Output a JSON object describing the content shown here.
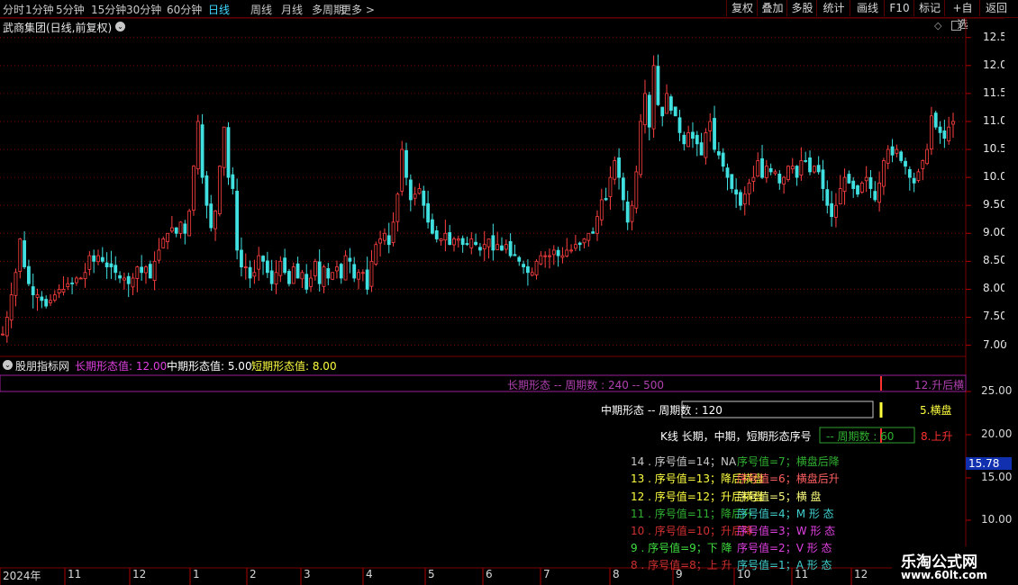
{
  "toolbar": {
    "periods": [
      {
        "label": "分时",
        "active": false
      },
      {
        "label": "1分钟",
        "active": false
      },
      {
        "label": "5分钟",
        "active": false
      },
      {
        "label": "15分钟",
        "active": false
      },
      {
        "label": "30分钟",
        "active": false
      },
      {
        "label": "60分钟",
        "active": false
      },
      {
        "label": "日线",
        "active": true
      },
      {
        "label": "周线",
        "active": false
      },
      {
        "label": "月线",
        "active": false
      },
      {
        "label": "多周期",
        "active": false
      },
      {
        "label": "更多 >",
        "active": false
      }
    ],
    "right_buttons": [
      "复权",
      "叠加",
      "多股",
      "统计",
      "画线",
      "F10",
      "标记",
      "+自选",
      "返回"
    ]
  },
  "chart": {
    "title": "武商集团(日线,前复权)",
    "price_axis": [
      "12.50",
      "12.00",
      "11.50",
      "11.00",
      "10.50",
      "10.00",
      "9.50",
      "9.00",
      "8.50",
      "8.00",
      "7.50",
      "7.00"
    ],
    "candles_close": [
      7.2,
      7.5,
      7.9,
      8.3,
      8.9,
      8.4,
      8.1,
      7.9,
      7.9,
      7.8,
      7.7,
      7.8,
      7.9,
      8.0,
      8.0,
      8.1,
      8.1,
      8.2,
      8.2,
      8.3,
      8.6,
      8.5,
      8.6,
      8.5,
      8.4,
      8.4,
      8.3,
      8.2,
      8.2,
      8.1,
      8.2,
      8.4,
      8.3,
      8.4,
      8.2,
      8.5,
      8.7,
      8.9,
      9.0,
      9.1,
      9.0,
      9.2,
      9.0,
      9.4,
      10.2,
      11.0,
      10.0,
      9.5,
      9.1,
      9.4,
      10.2,
      10.9,
      10.0,
      9.8,
      8.7,
      8.4,
      8.4,
      8.2,
      8.3,
      8.6,
      8.5,
      8.3,
      8.1,
      8.3,
      8.5,
      8.3,
      8.1,
      8.4,
      8.2,
      8.3,
      8.0,
      8.2,
      8.5,
      8.1,
      8.4,
      8.2,
      8.3,
      8.4,
      8.2,
      8.6,
      8.5,
      8.2,
      8.3,
      8.3,
      8.0,
      8.5,
      8.8,
      8.9,
      9.0,
      8.8,
      9.2,
      9.7,
      10.5,
      10.0,
      9.6,
      9.7,
      9.8,
      9.5,
      9.2,
      9.0,
      8.9,
      8.9,
      9.0,
      8.8,
      8.9,
      8.9,
      8.8,
      8.8,
      8.9,
      8.8,
      8.7,
      8.8,
      8.9,
      8.7,
      8.8,
      8.7,
      8.8,
      8.6,
      8.6,
      8.5,
      8.4,
      8.3,
      8.3,
      8.5,
      8.6,
      8.6,
      8.6,
      8.7,
      8.6,
      8.6,
      8.7,
      8.7,
      8.8,
      8.8,
      8.9,
      9.0,
      9.0,
      9.3,
      9.6,
      9.6,
      10.0,
      10.3,
      10.0,
      9.6,
      9.2,
      9.5,
      10.1,
      11.0,
      11.5,
      10.9,
      12.0,
      11.3,
      11.1,
      11.5,
      11.2,
      11.1,
      10.8,
      10.6,
      10.8,
      10.7,
      10.6,
      10.4,
      10.8,
      11.0,
      10.5,
      10.4,
      10.2,
      10.0,
      9.8,
      9.7,
      9.5,
      9.7,
      9.9,
      10.0,
      10.3,
      10.0,
      10.2,
      10.1,
      10.1,
      9.9,
      10.0,
      10.2,
      10.2,
      10.0,
      10.3,
      10.3,
      10.1,
      10.2,
      10.1,
      9.8,
      9.5,
      9.3,
      9.5,
      9.8,
      10.0,
      9.9,
      9.8,
      9.7,
      9.9,
      10.0,
      9.8,
      9.6,
      9.9,
      10.3,
      10.5,
      10.4,
      10.5,
      10.3,
      10.2,
      10.0,
      9.9,
      10.1,
      10.3,
      10.5,
      11.1,
      10.9,
      10.8,
      10.7,
      10.9,
      11.0
    ],
    "price_min": 6.8,
    "price_max": 12.85
  },
  "indicator": {
    "name": "股朋指标网",
    "long_label": "长期形态值: 12.00",
    "mid_label": "中期形态值: 5.00",
    "short_label": "短期形态值: 8.00",
    "colors": {
      "long": "#e040e0",
      "mid": "#ffffff",
      "short": "#ffff40"
    },
    "axis": [
      "25.00",
      "20.00",
      "15.00",
      "10.00"
    ],
    "current_value": "15.78",
    "long_band_text": "长期形态 -- 周期数 : 240 -- 500",
    "long_band_right": "12.升后横",
    "mid_text": "中期形态 -- 周期数 : 120",
    "mid_right": "5.横盘",
    "short_text_a": "K线 长期，中期，短期形态序号",
    "short_text_b": "-- 周期数 : 60",
    "short_right": "8.上升",
    "rows": [
      {
        "left": "14 . 序号值=14；NA",
        "right": "序号值=7；横盘后降",
        "lc": "#c8c8c8",
        "rc": "#30b030"
      },
      {
        "left": "13 . 序号值=13；降后横盘",
        "right": "序号值=6；横盘后升",
        "lc": "#ffff40",
        "rc": "#ff6060"
      },
      {
        "left": "12 . 序号值=12；升后横盘",
        "right": "序号值=5；横 盘",
        "lc": "#ffff40",
        "rc": "#ffff80"
      },
      {
        "left": "11 . 序号值=11；降后升",
        "right": "序号值=4；M 形 态",
        "lc": "#30b030",
        "rc": "#40d0d0"
      },
      {
        "left": "10 . 序号值=10；升后降",
        "right": "序号值=3；W 形 态",
        "lc": "#d03030",
        "rc": "#e040e0"
      },
      {
        "left": "9 . 序号值=9；下 降",
        "right": "序号值=2；V 形 态",
        "lc": "#40e040",
        "rc": "#e040e0"
      },
      {
        "left": "8 . 序号值=8；上 升",
        "right": "序号值=1；A 形 态",
        "lc": "#d03030",
        "rc": "#40d0d0"
      }
    ]
  },
  "dates": [
    "2024年",
    "11",
    "12",
    "1",
    "2",
    "3",
    "4",
    "5",
    "6",
    "7",
    "8",
    "9",
    "10",
    "11",
    "12"
  ],
  "watermark": {
    "line1": "乐淘公式网",
    "line2": "www.60lt.com"
  }
}
